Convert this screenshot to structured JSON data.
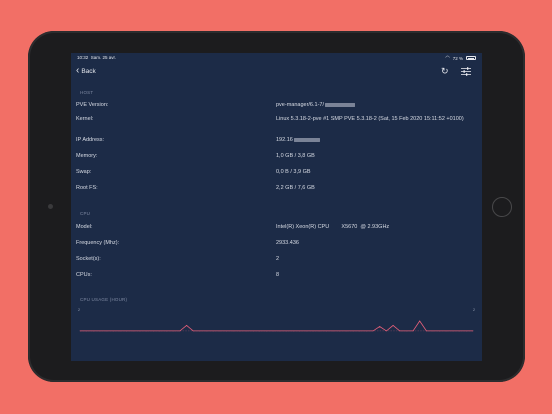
{
  "statusbar": {
    "time": "10:32",
    "date": "Sam. 25 avr.",
    "battery": "72 %"
  },
  "nav": {
    "back_label": "Back"
  },
  "sections": {
    "host": "HOST",
    "cpu": "CPU",
    "cpu_usage": "CPU USAGE (HOUR)"
  },
  "host": [
    {
      "key": "PVE Version:",
      "value": "pve-manager/6.1-7/"
    },
    {
      "key": "Kernel:",
      "value": "Linux 5.3.18-2-pve #1 SMP PVE 5.3.18-2 (Sat, 15 Feb 2020 15:11:52 +0100)"
    },
    {
      "key": "IP Address:",
      "value": "192.16"
    },
    {
      "key": "Memory:",
      "value": "1,0 GB / 3,8 GB"
    },
    {
      "key": "Swap:",
      "value": "0,0 B / 3,9 GB"
    },
    {
      "key": "Root FS:",
      "value": "2,2 GB / 7,6 GB"
    }
  ],
  "cpu": [
    {
      "key": "Model:",
      "value": "Intel(R) Xeon(R) CPU        X5670  @ 2.93GHz"
    },
    {
      "key": "Frequency (Mhz):",
      "value": "2933.436"
    },
    {
      "key": "Socket(s):",
      "value": "2"
    },
    {
      "key": "CPUs:",
      "value": "8"
    }
  ],
  "chart_data": {
    "type": "line",
    "title": "CPU USAGE (HOUR)",
    "ylim": [
      0,
      2
    ],
    "y_tick_labels": [
      "2",
      "2"
    ],
    "x": [
      0,
      1,
      2,
      3,
      4,
      5,
      6,
      7,
      8,
      9,
      10,
      11,
      12,
      13,
      14,
      15,
      16,
      17,
      18,
      19,
      20,
      21,
      22,
      23,
      24,
      25,
      26,
      27,
      28,
      29,
      30,
      31,
      32,
      33,
      34,
      35,
      36,
      37,
      38,
      39,
      40,
      41,
      42,
      43,
      44,
      45,
      46,
      47,
      48,
      49,
      50,
      51,
      52,
      53,
      54,
      55,
      56,
      57,
      58,
      59
    ],
    "values": [
      0.1,
      0.1,
      0.1,
      0.1,
      0.1,
      0.1,
      0.1,
      0.1,
      0.1,
      0.1,
      0.1,
      0.1,
      0.1,
      0.1,
      0.1,
      0.1,
      0.6,
      0.1,
      0.1,
      0.1,
      0.1,
      0.1,
      0.1,
      0.1,
      0.1,
      0.1,
      0.1,
      0.1,
      0.1,
      0.1,
      0.1,
      0.1,
      0.1,
      0.1,
      0.1,
      0.1,
      0.1,
      0.1,
      0.1,
      0.1,
      0.1,
      0.1,
      0.1,
      0.1,
      0.1,
      0.5,
      0.1,
      0.6,
      0.1,
      0.1,
      0.1,
      1.0,
      0.1,
      0.1,
      0.1,
      0.1,
      0.1,
      0.1,
      0.1,
      0.1
    ],
    "grid": false,
    "color": "#e8607a"
  }
}
